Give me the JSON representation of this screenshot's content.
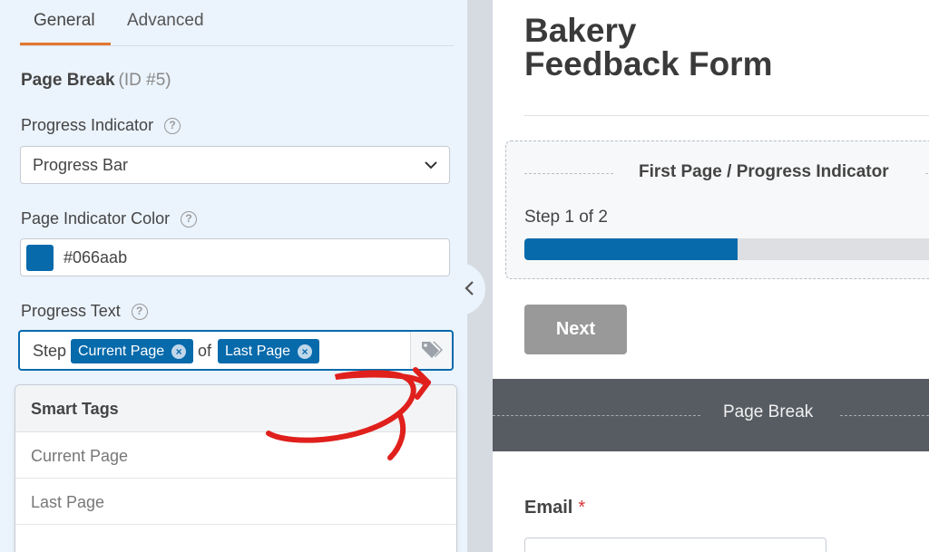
{
  "tabs": {
    "general": "General",
    "advanced": "Advanced"
  },
  "section": {
    "title": "Page Break",
    "id_text": "(ID #5)"
  },
  "progress_indicator": {
    "label": "Progress Indicator",
    "help": "?",
    "value": "Progress Bar"
  },
  "page_indicator_color": {
    "label": "Page Indicator Color",
    "help": "?",
    "value": "#066aab",
    "swatch": "#066aab"
  },
  "progress_text": {
    "label": "Progress Text",
    "help": "?",
    "prefix": "Step",
    "middle": "of",
    "tags": [
      "Current Page",
      "Last Page"
    ],
    "tag_remove": "×"
  },
  "smart_tags": {
    "header": "Smart Tags",
    "items": [
      "Current Page",
      "Last Page"
    ]
  },
  "form": {
    "title_line1": "Bakery",
    "title_line2": "Feedback Form",
    "pi_title": "First Page / Progress Indicator",
    "step_text": "Step 1 of 2",
    "progress": 0.5,
    "next_label": "Next",
    "page_break_label": "Page Break",
    "email_label": "Email",
    "email_required": "*"
  },
  "colors": {
    "accent": "#066aab",
    "tab_active": "#e27730",
    "annotation": "#e0201c"
  }
}
